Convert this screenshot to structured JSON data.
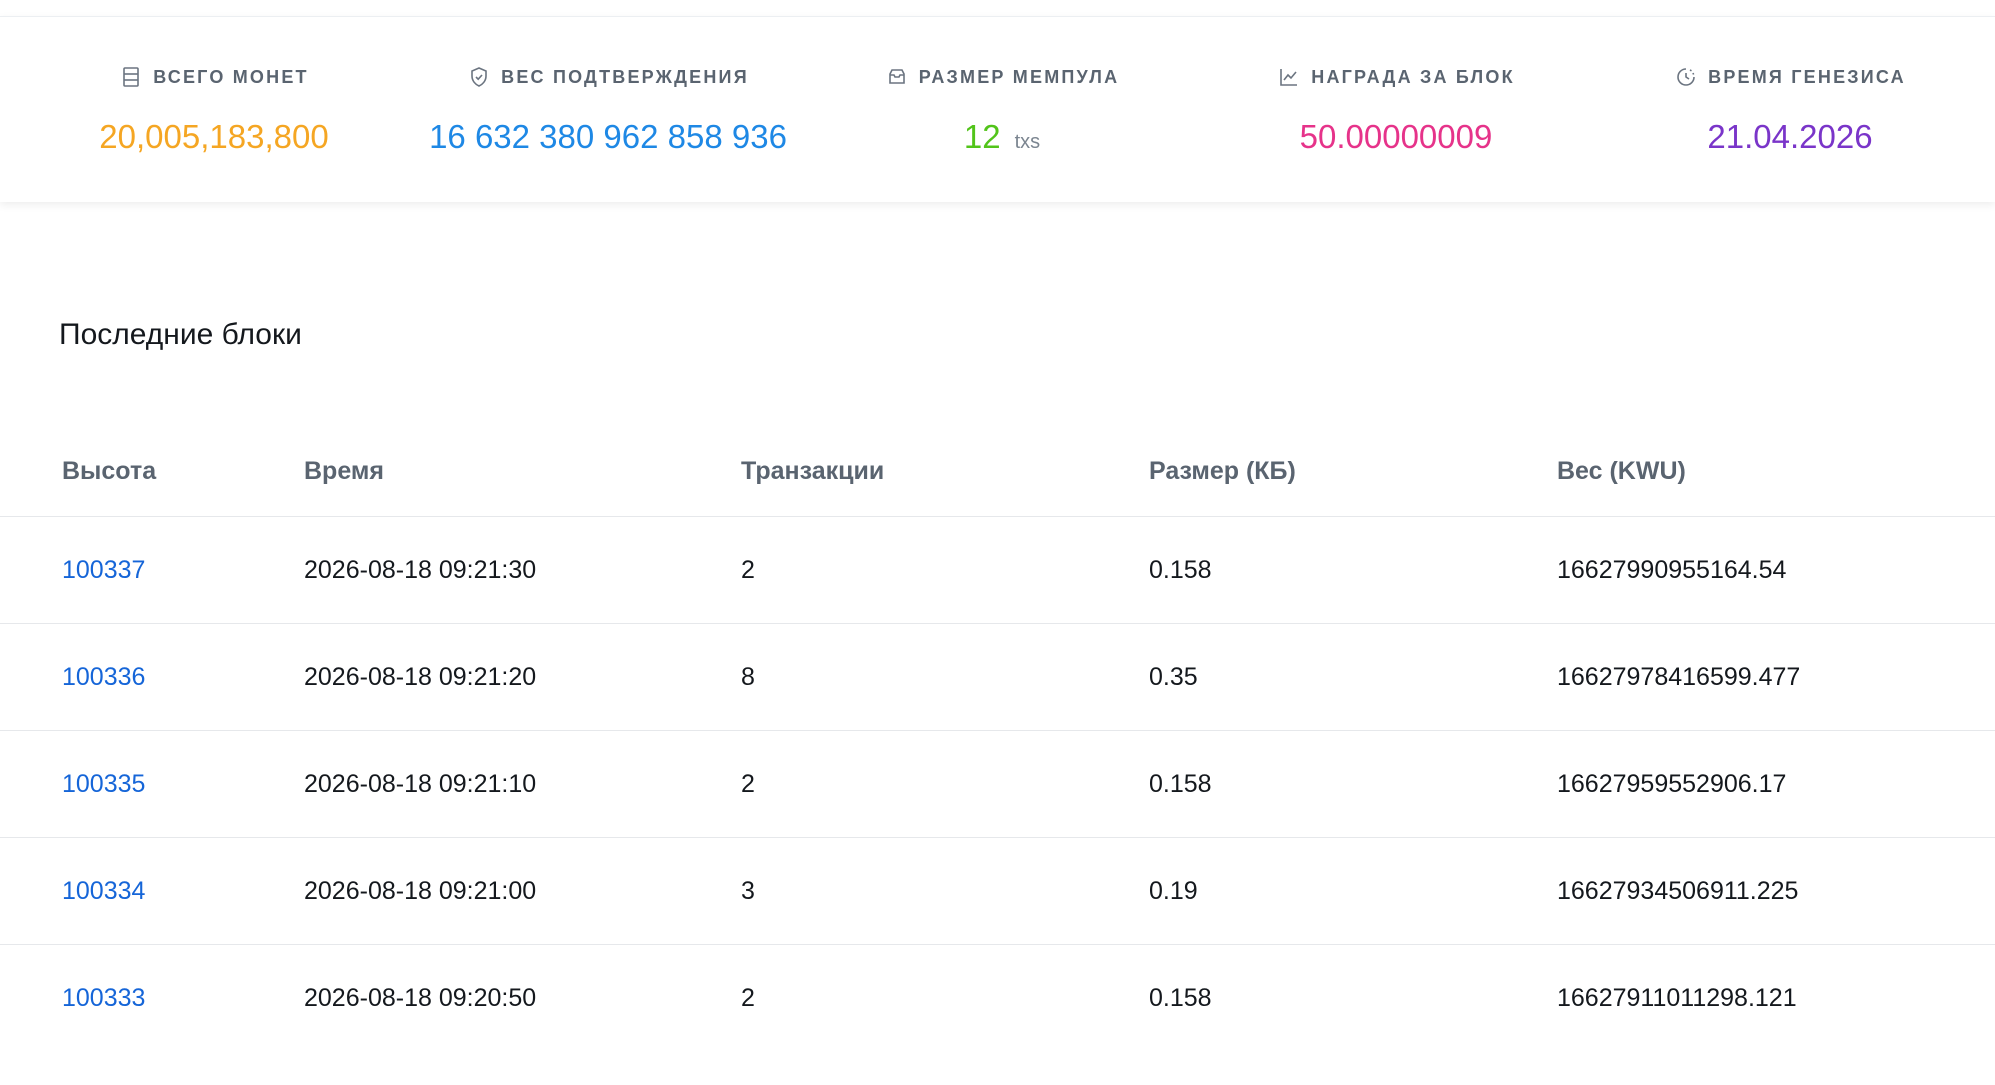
{
  "stats": [
    {
      "label": "ВСЕГО МОНЕТ",
      "value": "20,005,183,800",
      "unit": "",
      "color": "#f5a623",
      "icon": "server-icon"
    },
    {
      "label": "ВЕС ПОДТВЕРЖДЕНИЯ",
      "value": "16 632 380 962 858 936",
      "unit": "",
      "color": "#1e88e5",
      "icon": "shield-check-icon"
    },
    {
      "label": "РАЗМЕР МЕМПУЛА",
      "value": "12",
      "unit": "txs",
      "color": "#52c41a",
      "icon": "inbox-icon"
    },
    {
      "label": "НАГРАДА ЗА БЛОК",
      "value": "50.00000009",
      "unit": "",
      "color": "#e6338a",
      "icon": "line-chart-icon"
    },
    {
      "label": "ВРЕМЯ ГЕНЕЗИСА",
      "value": "21.04.2026",
      "unit": "",
      "color": "#7a35c9",
      "icon": "clock-history-icon"
    }
  ],
  "blocks_section": {
    "title": "Последние блоки",
    "columns": [
      "Высота",
      "Время",
      "Транзакции",
      "Размер (КБ)",
      "Вес (KWU)"
    ],
    "rows": [
      {
        "height": "100337",
        "time": "2026-08-18 09:21:30",
        "txs": "2",
        "size": "0.158",
        "weight": "16627990955164.54"
      },
      {
        "height": "100336",
        "time": "2026-08-18 09:21:20",
        "txs": "8",
        "size": "0.35",
        "weight": "16627978416599.477"
      },
      {
        "height": "100335",
        "time": "2026-08-18 09:21:10",
        "txs": "2",
        "size": "0.158",
        "weight": "16627959552906.17"
      },
      {
        "height": "100334",
        "time": "2026-08-18 09:21:00",
        "txs": "3",
        "size": "0.19",
        "weight": "16627934506911.225"
      },
      {
        "height": "100333",
        "time": "2026-08-18 09:20:50",
        "txs": "2",
        "size": "0.158",
        "weight": "16627911011298.121"
      }
    ]
  }
}
